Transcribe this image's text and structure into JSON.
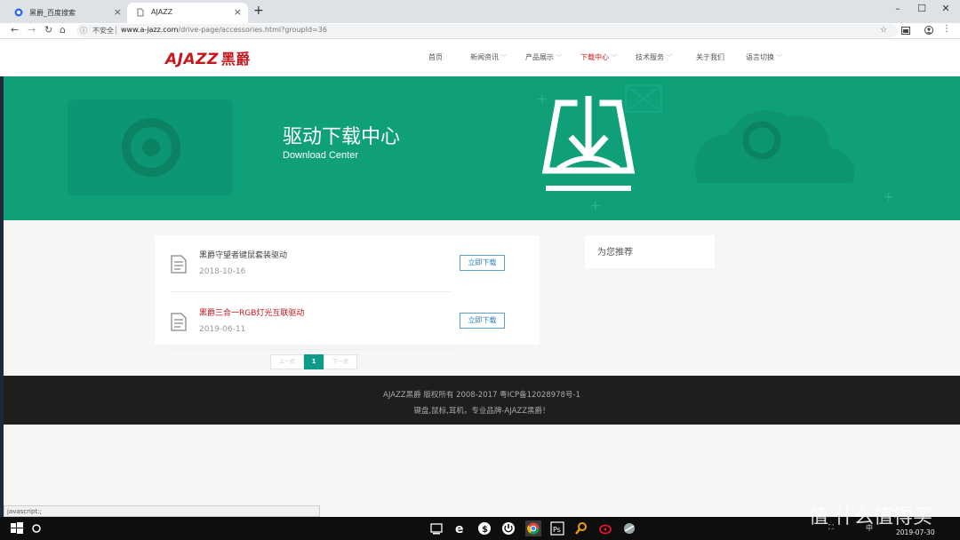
{
  "browser": {
    "tabs": [
      {
        "label": "黑爵_百度搜索",
        "close": "×"
      },
      {
        "label": "AJAZZ",
        "close": "×"
      }
    ],
    "new_tab": "+",
    "window_controls": {
      "minimize": "–",
      "maximize": "☐",
      "close": "✕"
    },
    "nav": {
      "back": "←",
      "forward": "→",
      "reload": "↻",
      "home": "⌂"
    },
    "security_label": "不安全",
    "url_host": "www.a-jazz.com",
    "url_path": "/drive-page/accessories.html?groupId=36",
    "status_text": "javascript:;"
  },
  "site": {
    "logo_text": "AJAZZ",
    "logo_cn": "黑爵",
    "nav_items": [
      {
        "label": "首页",
        "has_caret": false,
        "active": false
      },
      {
        "label": "新闻资讯",
        "has_caret": true,
        "active": false
      },
      {
        "label": "产品展示",
        "has_caret": true,
        "active": false
      },
      {
        "label": "下载中心",
        "has_caret": true,
        "active": true
      },
      {
        "label": "技术服务",
        "has_caret": true,
        "active": false
      },
      {
        "label": "关于我们",
        "has_caret": false,
        "active": false
      },
      {
        "label": "语言切换",
        "has_caret": true,
        "active": false
      }
    ],
    "caret": "﹀"
  },
  "banner": {
    "title": "驱动下载中心",
    "subtitle": "Download Center",
    "bg_color": "#0fa07a"
  },
  "downloads": [
    {
      "title": "黑爵守望者键鼠套装驱动",
      "date": "2018-10-16",
      "button": "立即下载",
      "highlight": false
    },
    {
      "title": "黑爵三合一RGB灯光互联驱动",
      "date": "2019-06-11",
      "button": "立即下载",
      "highlight": true
    }
  ],
  "pagination": {
    "prev": "上一页",
    "current": "1",
    "next": "下一页"
  },
  "sidebar": {
    "recommend_title": "为您推荐"
  },
  "footer": {
    "line1": "AJAZZ黑爵 版权所有 2008-2017 粤ICP备12028978号-1",
    "line2": "键盘,鼠标,耳机，专业品牌-AJAZZ黑爵！"
  },
  "taskbar": {
    "time": "",
    "date": "2019-07-30",
    "ime": "中"
  },
  "watermark": "值 什么值得买",
  "colors": {
    "accent_red": "#c8161d",
    "teal": "#0f9b87",
    "link_blue": "#2e7fc4"
  }
}
